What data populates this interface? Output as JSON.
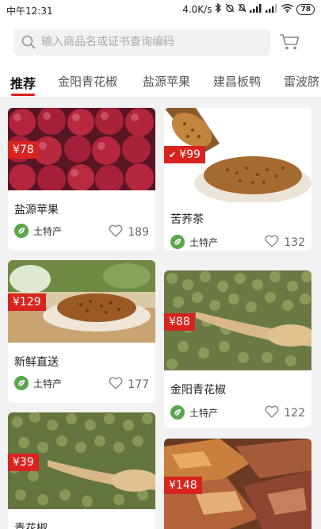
{
  "status": {
    "time": "中午12:31",
    "speed": "4.0K/s",
    "battery": "78"
  },
  "search": {
    "placeholder": "输入商品名或证书查询编码"
  },
  "tabs": [
    {
      "label": "推荐"
    },
    {
      "label": "金阳青花椒"
    },
    {
      "label": "盐源苹果"
    },
    {
      "label": "建昌板鸭"
    },
    {
      "label": "雷波脐"
    }
  ],
  "products": [
    {
      "price": "¥78",
      "title": "盐源苹果",
      "tag": "土特产",
      "likes": "189"
    },
    {
      "price": "¥99",
      "title": "苦荞茶",
      "tag": "土特产",
      "likes": "132"
    },
    {
      "price": "¥129",
      "title": "新鲜直送",
      "tag": "土特产",
      "likes": "177"
    },
    {
      "price": "¥88",
      "title": "金阳青花椒",
      "tag": "土特产",
      "likes": "122"
    },
    {
      "price": "¥39",
      "title": "青花椒"
    },
    {
      "price": "¥148"
    }
  ],
  "colors": {
    "accent": "#d81e1e",
    "price_bg": "#d8231f",
    "tag_leaf": "#5aa64a"
  },
  "icons": [
    "search-icon",
    "cart-icon",
    "heart-icon",
    "leaf-icon",
    "bluetooth-icon",
    "wifi-icon",
    "signal-icon",
    "battery-icon"
  ]
}
